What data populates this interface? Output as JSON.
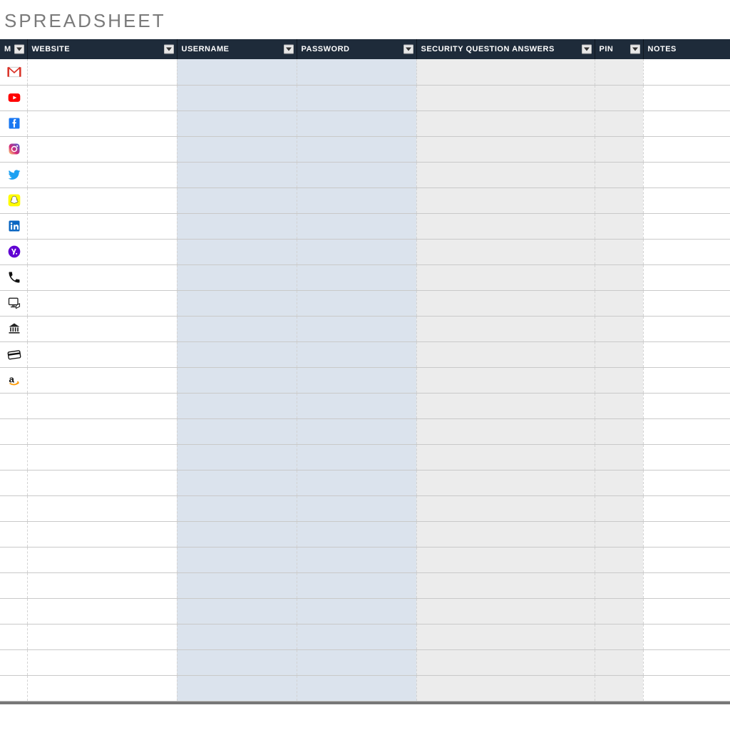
{
  "title": "SPREADSHEET",
  "columns": {
    "icon": "M",
    "website": "WEBSITE",
    "username": "USERNAME",
    "password": "PASSWORD",
    "secq": "SECURITY QUESTION ANSWERS",
    "pin": "PIN",
    "notes": "NOTES"
  },
  "rows": [
    {
      "icon": "gmail",
      "website": "",
      "username": "",
      "password": "",
      "secq": "",
      "pin": "",
      "notes": ""
    },
    {
      "icon": "youtube",
      "website": "",
      "username": "",
      "password": "",
      "secq": "",
      "pin": "",
      "notes": ""
    },
    {
      "icon": "facebook",
      "website": "",
      "username": "",
      "password": "",
      "secq": "",
      "pin": "",
      "notes": ""
    },
    {
      "icon": "instagram",
      "website": "",
      "username": "",
      "password": "",
      "secq": "",
      "pin": "",
      "notes": ""
    },
    {
      "icon": "twitter",
      "website": "",
      "username": "",
      "password": "",
      "secq": "",
      "pin": "",
      "notes": ""
    },
    {
      "icon": "snapchat",
      "website": "",
      "username": "",
      "password": "",
      "secq": "",
      "pin": "",
      "notes": ""
    },
    {
      "icon": "linkedin",
      "website": "",
      "username": "",
      "password": "",
      "secq": "",
      "pin": "",
      "notes": ""
    },
    {
      "icon": "yahoo",
      "website": "",
      "username": "",
      "password": "",
      "secq": "",
      "pin": "",
      "notes": ""
    },
    {
      "icon": "phone",
      "website": "",
      "username": "",
      "password": "",
      "secq": "",
      "pin": "",
      "notes": ""
    },
    {
      "icon": "computer",
      "website": "",
      "username": "",
      "password": "",
      "secq": "",
      "pin": "",
      "notes": ""
    },
    {
      "icon": "bank",
      "website": "",
      "username": "",
      "password": "",
      "secq": "",
      "pin": "",
      "notes": ""
    },
    {
      "icon": "card",
      "website": "",
      "username": "",
      "password": "",
      "secq": "",
      "pin": "",
      "notes": ""
    },
    {
      "icon": "amazon",
      "website": "",
      "username": "",
      "password": "",
      "secq": "",
      "pin": "",
      "notes": ""
    },
    {
      "icon": "",
      "website": "",
      "username": "",
      "password": "",
      "secq": "",
      "pin": "",
      "notes": ""
    },
    {
      "icon": "",
      "website": "",
      "username": "",
      "password": "",
      "secq": "",
      "pin": "",
      "notes": ""
    },
    {
      "icon": "",
      "website": "",
      "username": "",
      "password": "",
      "secq": "",
      "pin": "",
      "notes": ""
    },
    {
      "icon": "",
      "website": "",
      "username": "",
      "password": "",
      "secq": "",
      "pin": "",
      "notes": ""
    },
    {
      "icon": "",
      "website": "",
      "username": "",
      "password": "",
      "secq": "",
      "pin": "",
      "notes": ""
    },
    {
      "icon": "",
      "website": "",
      "username": "",
      "password": "",
      "secq": "",
      "pin": "",
      "notes": ""
    },
    {
      "icon": "",
      "website": "",
      "username": "",
      "password": "",
      "secq": "",
      "pin": "",
      "notes": ""
    },
    {
      "icon": "",
      "website": "",
      "username": "",
      "password": "",
      "secq": "",
      "pin": "",
      "notes": ""
    },
    {
      "icon": "",
      "website": "",
      "username": "",
      "password": "",
      "secq": "",
      "pin": "",
      "notes": ""
    },
    {
      "icon": "",
      "website": "",
      "username": "",
      "password": "",
      "secq": "",
      "pin": "",
      "notes": ""
    },
    {
      "icon": "",
      "website": "",
      "username": "",
      "password": "",
      "secq": "",
      "pin": "",
      "notes": ""
    },
    {
      "icon": "",
      "website": "",
      "username": "",
      "password": "",
      "secq": "",
      "pin": "",
      "notes": ""
    }
  ]
}
